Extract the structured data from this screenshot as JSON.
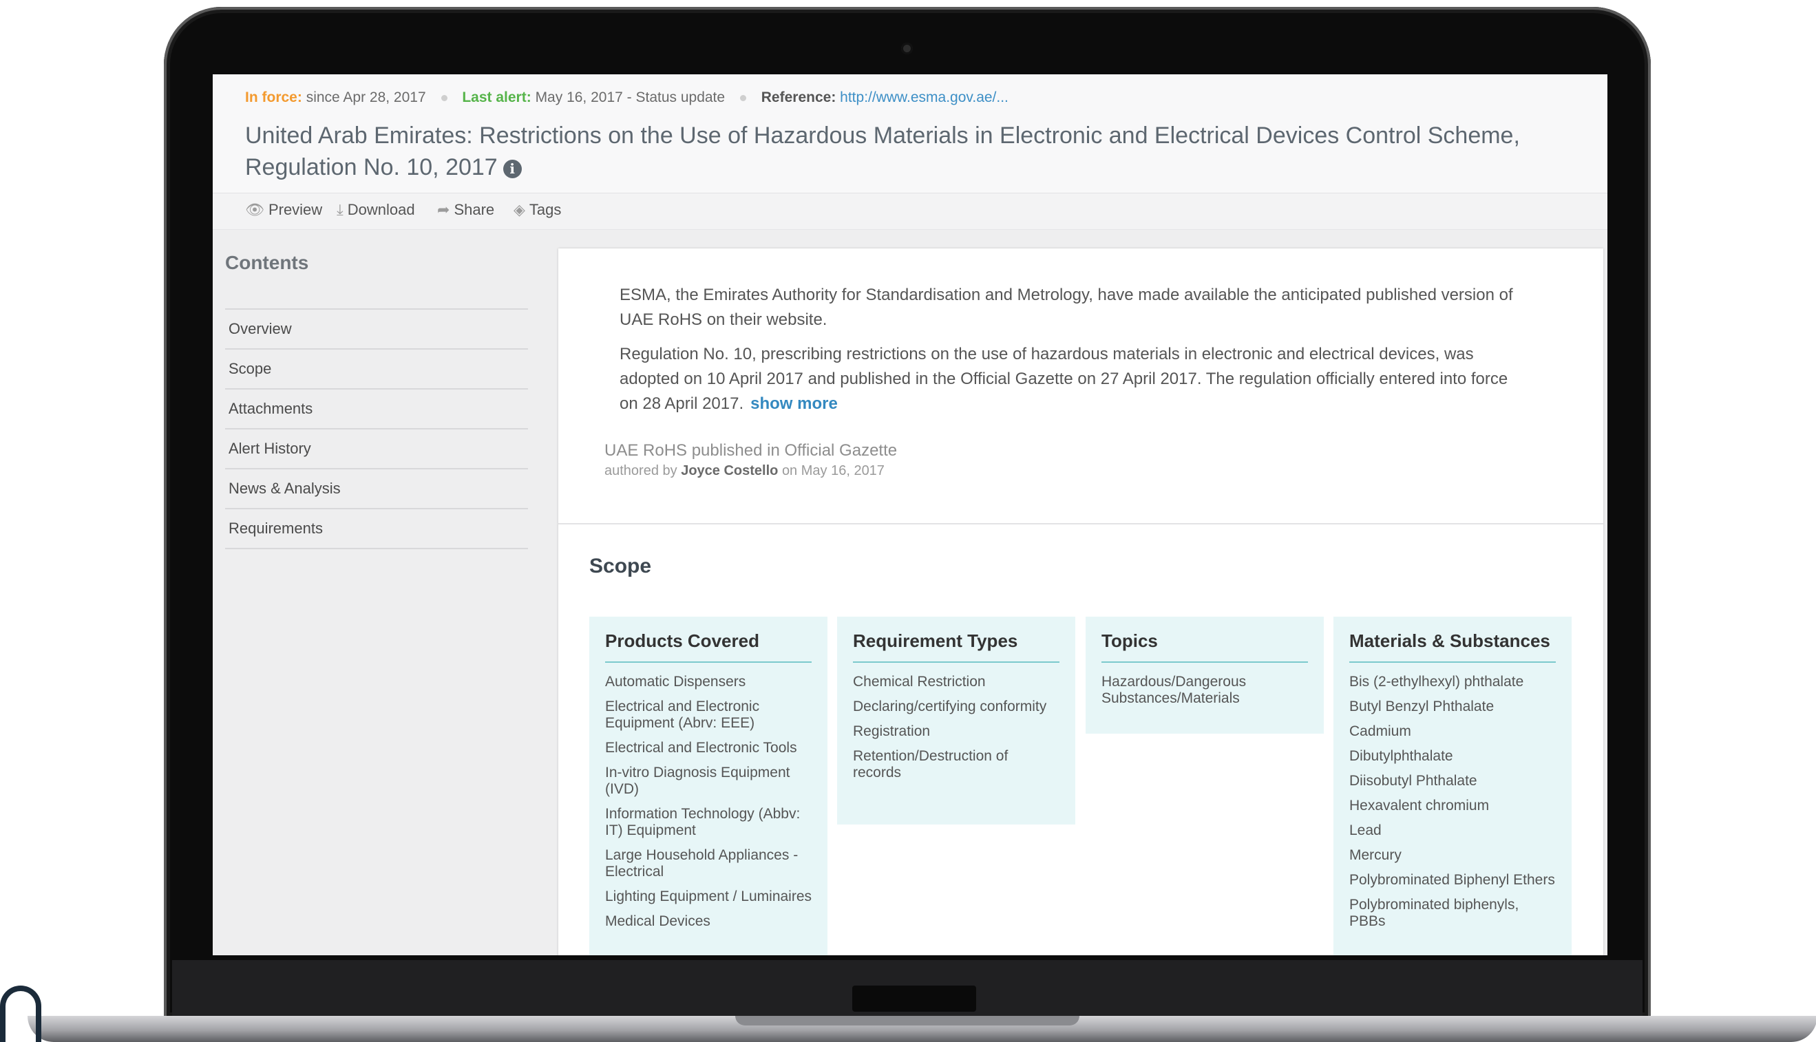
{
  "meta": {
    "in_force_label": "In force:",
    "in_force_value": "since Apr 28, 2017",
    "last_alert_label": "Last alert:",
    "last_alert_value": "May 16, 2017 - Status update",
    "reference_label": "Reference:",
    "reference_value": "http://www.esma.gov.ae/..."
  },
  "title": "United Arab Emirates: Restrictions on the Use of Hazardous Materials in Electronic and Electrical Devices Control Scheme, Regulation No. 10, 2017",
  "info_icon": "i",
  "toolbar": {
    "preview": "Preview",
    "download": "Download",
    "share": "Share",
    "tags": "Tags"
  },
  "sidebar": {
    "title": "Contents",
    "items": [
      "Overview",
      "Scope",
      "Attachments",
      "Alert History",
      "News & Analysis",
      "Requirements"
    ]
  },
  "summary": {
    "p1": "ESMA, the Emirates Authority for Standardisation and Metrology, have made available the anticipated published version of UAE RoHS on their website.",
    "p2": "Regulation No. 10, prescribing restrictions on the use of hazardous materials in electronic and electrical devices, was adopted on 10 April 2017 and published in the Official Gazette on 27 April 2017. The regulation officially entered into force on 28 April 2017.",
    "show_more": "show more"
  },
  "byline": {
    "title": "UAE RoHS published in Official Gazette",
    "authored_by": "authored by",
    "author": "Joyce Costello",
    "date": "on May 16, 2017"
  },
  "scope": {
    "heading": "Scope",
    "cards": [
      {
        "title": "Products Covered",
        "items": [
          "Automatic Dispensers",
          "Electrical and Electronic Equipment (Abrv: EEE)",
          "Electrical and Electronic Tools",
          "In-vitro Diagnosis Equipment (IVD)",
          "Information Technology (Abbv: IT) Equipment",
          "Large Household Appliances - Electrical",
          "Lighting Equipment / Luminaires",
          "Medical Devices"
        ]
      },
      {
        "title": "Requirement Types",
        "items": [
          "Chemical Restriction",
          "Declaring/certifying conformity",
          "Registration",
          "Retention/Destruction of records"
        ]
      },
      {
        "title": "Topics",
        "items": [
          "Hazardous/Dangerous Substances/Materials"
        ]
      },
      {
        "title": "Materials & Substances",
        "items": [
          "Bis (2-ethylhexyl) phthalate",
          "Butyl Benzyl Phthalate",
          "Cadmium",
          "Dibutylphthalate",
          "Diisobutyl Phthalate",
          "Hexavalent chromium",
          "Lead",
          "Mercury",
          "Polybrominated Biphenyl Ethers",
          "Polybrominated biphenyls, PBBs"
        ]
      }
    ]
  }
}
